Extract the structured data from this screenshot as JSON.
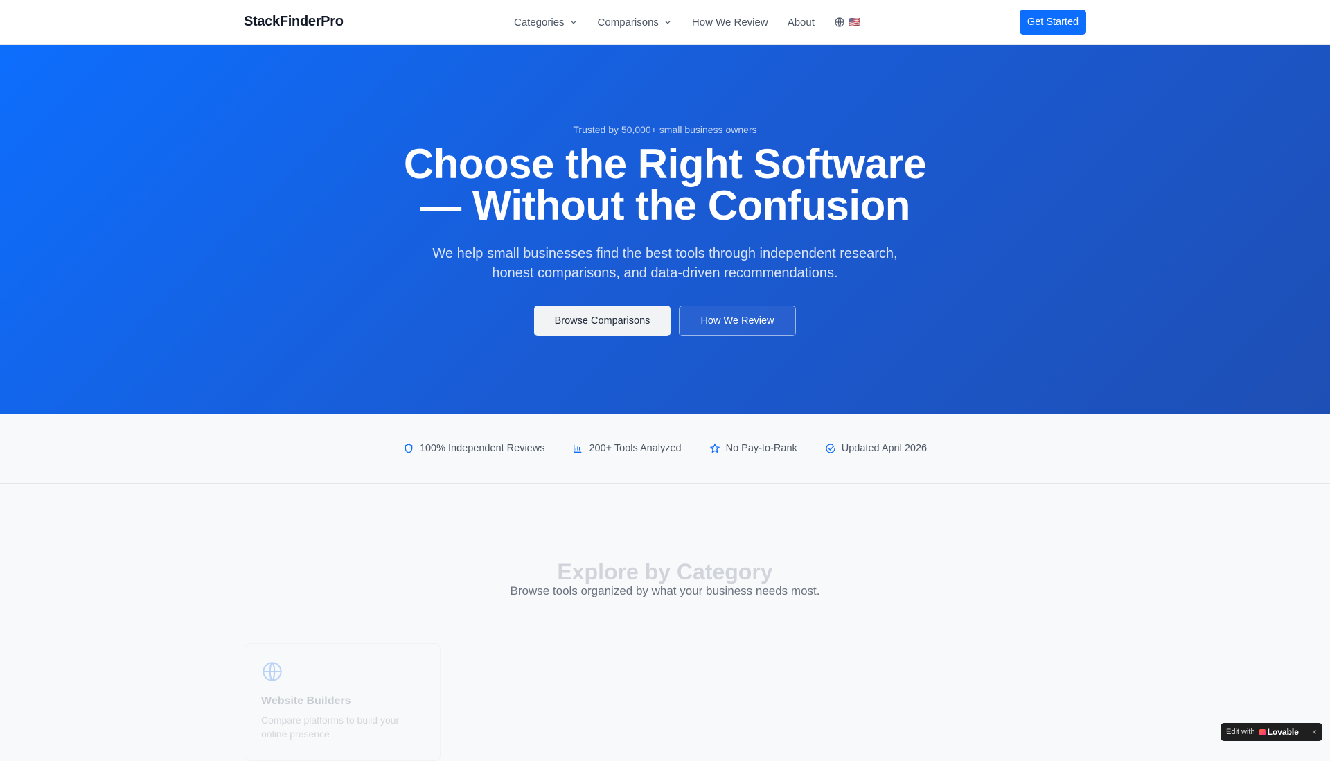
{
  "header": {
    "logo": "StackFinderPro",
    "nav": [
      {
        "label": "Categories",
        "has_dropdown": true
      },
      {
        "label": "Comparisons",
        "has_dropdown": true
      },
      {
        "label": "How We Review",
        "has_dropdown": false
      },
      {
        "label": "About",
        "has_dropdown": false
      }
    ],
    "language_flag": "🇺🇸",
    "cta_label": "Get Started"
  },
  "hero": {
    "trusted": "Trusted by 50,000+ small business owners",
    "title_line1": "Choose the Right Software",
    "title_line2": "— Without the Confusion",
    "subtitle_line1": "We help small businesses find the best tools through independent research,",
    "subtitle_line2": "honest comparisons, and data-driven recommendations.",
    "primary_button": "Browse Comparisons",
    "secondary_button": "How We Review"
  },
  "trust": [
    {
      "icon": "shield-icon",
      "label": "100% Independent Reviews"
    },
    {
      "icon": "bar-chart-icon",
      "label": "200+ Tools Analyzed"
    },
    {
      "icon": "star-icon",
      "label": "No Pay-to-Rank"
    },
    {
      "icon": "check-circle-icon",
      "label": "Updated April 2026"
    }
  ],
  "categories": {
    "title": "Explore by Category",
    "subtitle": "Browse tools organized by what your business needs most.",
    "cards": [
      {
        "icon": "globe-icon",
        "title": "Website Builders",
        "description": "Compare platforms to build your online presence"
      }
    ]
  },
  "badge": {
    "prefix": "Edit with",
    "brand": "Lovable",
    "close": "×"
  },
  "colors": {
    "primary": "#0d6efd",
    "hero_end": "#1e4fb5"
  }
}
